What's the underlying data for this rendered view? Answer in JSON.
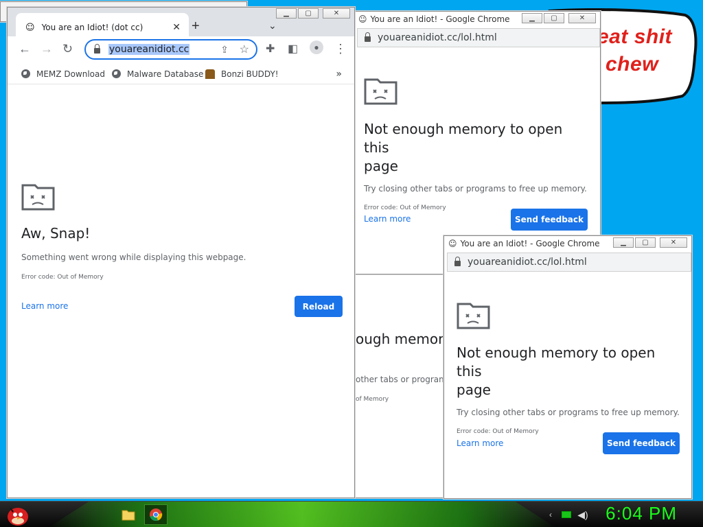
{
  "bubble": {
    "line1": "eat shit",
    "line2": "chew"
  },
  "main_window": {
    "tab_title": "You are an Idiot! (dot cc)",
    "url": "youareanidiot.cc",
    "bookmarks": [
      "MEMZ Download",
      "Malware Database",
      "Bonzi BUDDY!"
    ],
    "error": {
      "title": "Aw, Snap!",
      "message": "Something went wrong while displaying this webpage.",
      "code": "Error code: Out of Memory",
      "learn_more": "Learn more",
      "button": "Reload"
    }
  },
  "popup_top": {
    "title": "You are an Idiot! - Google Chrome",
    "url": "youareanidiot.cc/lol.html",
    "error": {
      "title_line1": "Not enough memory to open this",
      "title_line2": "page",
      "message": "Try closing other tabs or programs to free up memory.",
      "code": "Error code: Out of Memory",
      "learn_more": "Learn more",
      "button": "Send feedback"
    }
  },
  "popup_middle": {
    "title_fragment": "ough memory",
    "message_fragment": "other tabs or programs t",
    "code_fragment": "of Memory"
  },
  "popup_bottom": {
    "title": "You are an Idiot! - Google Chrome",
    "url": "youareanidiot.cc/lol.html",
    "error": {
      "title_line1": "Not enough memory to open this",
      "title_line2": "page",
      "message": "Try closing other tabs or programs to free up memory.",
      "code": "Error code: Out of Memory",
      "learn_more": "Learn more",
      "button": "Send feedback"
    }
  },
  "taskbar": {
    "clock": "6:04 PM"
  },
  "colors": {
    "accent": "#1a73e8",
    "desktop": "#00a6f0",
    "clock": "#19ff19",
    "bubble_text": "#e0201b"
  }
}
